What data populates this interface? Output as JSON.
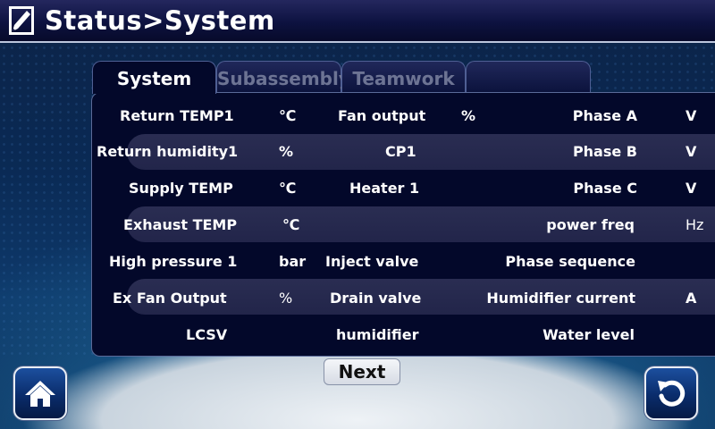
{
  "header": {
    "title": "Status>System"
  },
  "tabs": [
    {
      "label": "System",
      "active": true
    },
    {
      "label": "Subassembly",
      "active": false
    },
    {
      "label": "Teamwork",
      "active": false
    },
    {
      "label": "",
      "active": false
    }
  ],
  "rows": [
    {
      "c1": "Return TEMP1",
      "u1": "℃",
      "c2": "Fan output",
      "u2": "%",
      "c3": "Phase A",
      "u3": "V"
    },
    {
      "c1": "Return humidity1",
      "u1": "%",
      "c2": "CP1",
      "u2": "",
      "c3": "Phase B",
      "u3": "V"
    },
    {
      "c1": "Supply TEMP",
      "u1": "℃",
      "c2": "Heater 1",
      "u2": "",
      "c3": "Phase C",
      "u3": "V"
    },
    {
      "c1": "Exhaust TEMP",
      "u1": "℃",
      "c2": "",
      "u2": "",
      "c3": "power freq",
      "u3": "Hz"
    },
    {
      "c1": "High pressure 1",
      "u1": "bar",
      "c2": "Inject valve",
      "u2": "",
      "c3": "Phase sequence",
      "u3": ""
    },
    {
      "c1": "Ex Fan Output",
      "u1": "%",
      "c2": "Drain valve",
      "u2": "",
      "c3": "Humidifier current",
      "u3": "A"
    },
    {
      "c1": "LCSV",
      "u1": "",
      "c2": "humidifier",
      "u2": "",
      "c3": "Water level",
      "u3": ""
    }
  ],
  "footer": {
    "next_label": "Next",
    "home_icon": "home-icon",
    "back_icon": "back-icon"
  },
  "colors": {
    "title_bar": "#0d1240",
    "panel": "#03082a",
    "row_band": "#2a2d52",
    "button_blue": "#0a2c6b"
  }
}
